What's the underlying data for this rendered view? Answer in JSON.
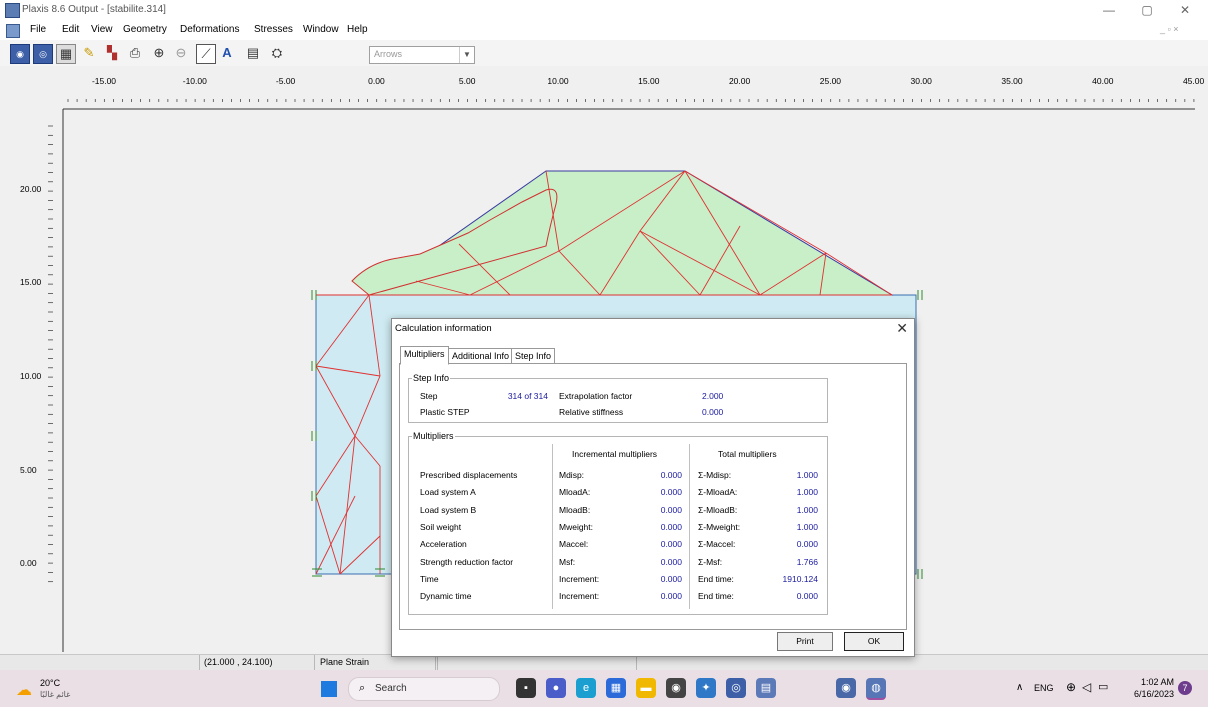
{
  "window": {
    "title": "Plaxis 8.6 Output - [stabilite.314]",
    "minimize": "—",
    "restore": "▢",
    "close": "✕",
    "doc_controls": "_ ▫ ×"
  },
  "menu": [
    "File",
    "Edit",
    "View",
    "Geometry",
    "Deformations",
    "Stresses",
    "Window",
    "Help"
  ],
  "toolbar": {
    "combo_value": "Arrows"
  },
  "ruler": {
    "x_ticks": [
      "-15.00",
      "-10.00",
      "-5.00",
      "0.00",
      "5.00",
      "10.00",
      "15.00",
      "20.00",
      "25.00",
      "30.00",
      "35.00",
      "40.00",
      "45.00"
    ],
    "y_ticks": [
      "20.00",
      "15.00",
      "10.00",
      "5.00",
      "0.00"
    ]
  },
  "status": {
    "coords": "(21.000 , 24.100)",
    "mode": "Plane Strain"
  },
  "dialog": {
    "title": "Calculation information",
    "tabs": [
      "Multipliers",
      "Additional Info",
      "Step Info"
    ],
    "step_info": {
      "label": "Step Info",
      "step_label": "Step",
      "step_value": "314 of 314",
      "extrap_label": "Extrapolation factor",
      "extrap_value": "2.000",
      "plastic_label": "Plastic STEP",
      "stiff_label": "Relative stiffness",
      "stiff_value": "0.000"
    },
    "multipliers": {
      "label": "Multipliers",
      "inc_header": "Incremental multipliers",
      "tot_header": "Total multipliers",
      "rows": [
        [
          "Prescribed displacements",
          "Mdisp:",
          "0.000",
          "Σ-Mdisp:",
          "1.000"
        ],
        [
          "Load system A",
          "MloadA:",
          "0.000",
          "Σ-MloadA:",
          "1.000"
        ],
        [
          "Load system B",
          "MloadB:",
          "0.000",
          "Σ-MloadB:",
          "1.000"
        ],
        [
          "Soil weight",
          "Mweight:",
          "0.000",
          "Σ-Mweight:",
          "1.000"
        ],
        [
          "Acceleration",
          "Maccel:",
          "0.000",
          "Σ-Maccel:",
          "0.000"
        ],
        [
          "Strength reduction factor",
          "Msf:",
          "0.000",
          "Σ-Msf:",
          "1.766"
        ],
        [
          "Time",
          "Increment:",
          "0.000",
          "End time:",
          "1910.124"
        ],
        [
          "Dynamic time",
          "Increment:",
          "0.000",
          "End time:",
          "0.000"
        ]
      ]
    },
    "print_button": "Print",
    "ok_button": "OK"
  },
  "taskbar": {
    "weather_temp": "20°C",
    "weather_desc": "غائم غالبًا",
    "search_placeholder": "Search",
    "lang": "ENG",
    "time": "1:02 AM",
    "date": "6/16/2023",
    "notif_count": "7"
  }
}
